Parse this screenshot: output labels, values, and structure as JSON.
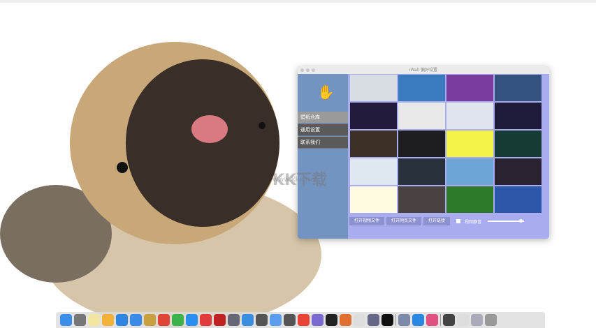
{
  "window": {
    "title": "iWall 偏好设置"
  },
  "sidebar": {
    "items": [
      {
        "label": "壁纸仓库",
        "active": true
      },
      {
        "label": "通用设置"
      },
      {
        "label": "联系我们"
      }
    ]
  },
  "wallpapers": [
    {
      "name": "clouds",
      "color": "#d8dde4"
    },
    {
      "name": "wave",
      "color": "#3a7bc0"
    },
    {
      "name": "purple-tree",
      "color": "#7a3c9c"
    },
    {
      "name": "lake-sunset",
      "color": "#34527e"
    },
    {
      "name": "dark-rain",
      "color": "#241a3c"
    },
    {
      "name": "clock",
      "color": "#e8e8e8"
    },
    {
      "name": "minimal-card",
      "color": "#e1e6ee"
    },
    {
      "name": "digital-time",
      "color": "#1d1a3a"
    },
    {
      "name": "night-road",
      "color": "#3d3026"
    },
    {
      "name": "red-digits",
      "color": "#1e1e22"
    },
    {
      "name": "yellow",
      "color": "#f4f34a"
    },
    {
      "name": "matrix-green",
      "color": "#163a34"
    },
    {
      "name": "pastel-sky",
      "color": "#dfe8f0"
    },
    {
      "name": "dark-clock",
      "color": "#28313c"
    },
    {
      "name": "mountain-lake",
      "color": "#6fa4d8"
    },
    {
      "name": "dark-circle",
      "color": "#2a2230"
    },
    {
      "name": "emoji",
      "color": "#fffbe0"
    },
    {
      "name": "dark-portal",
      "color": "#4a4240"
    },
    {
      "name": "bamboo",
      "color": "#2e7a2a"
    },
    {
      "name": "blue-wave",
      "color": "#2d57a8"
    }
  ],
  "controls": {
    "open_video": "打开视频文件",
    "open_web": "打开网页文件",
    "open_link": "打开链接",
    "mute_label": "视频静音",
    "volume": 0.95
  },
  "watermark": {
    "brand": "KK下载",
    "url": "www.kkx.net"
  },
  "dock": [
    "#3b8ee8",
    "#777",
    "#f2e6a0",
    "#f3b23a",
    "#2f86e0",
    "#3a8ae8",
    "#c9a040",
    "#e04434",
    "#3bb34a",
    "#2a8ef0",
    "#e33b3b",
    "#c02222",
    "#667",
    "#3a8ee0",
    "#555",
    "#5b9ef0",
    "#555",
    "#ea4335",
    "#7a6ad0",
    "#222",
    "#e07030",
    "#ddd",
    "#668",
    "#111",
    "sep",
    "#7a8aa8",
    "#2a88e0",
    "#e05080",
    "sep",
    "#444",
    "#ddd",
    "#aab",
    "#999"
  ]
}
